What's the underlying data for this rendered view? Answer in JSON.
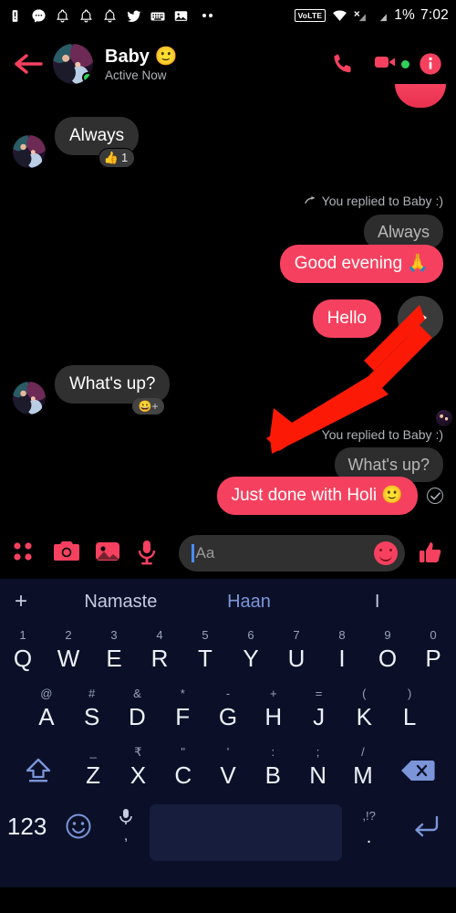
{
  "statusbar": {
    "icons": [
      "battery-alert-icon",
      "messenger-chat-icon",
      "bell-icon",
      "bell-icon",
      "bell-icon",
      "twitter-bird-icon",
      "keyboard-icon",
      "image-icon",
      "more-dots-icon"
    ],
    "volte_label": "VoLTE",
    "wifi_icon": "wifi-icon",
    "signal_icons": [
      "signal-no-service-icon",
      "signal-bars-icon"
    ],
    "battery_percent": "1%",
    "time": "7:02"
  },
  "header": {
    "back_icon": "back-arrow-icon",
    "avatar_name": "avatar",
    "name": "Baby 🙂",
    "status": "Active Now",
    "call_icon": "phone-call-icon",
    "video_icon": "video-call-icon",
    "info_icon": "info-icon"
  },
  "thread": {
    "messages": [
      {
        "id": "m1",
        "direction": "in",
        "text": "Always",
        "reaction": {
          "emoji": "👍",
          "count": "1"
        }
      },
      {
        "id": "m2",
        "direction": "out",
        "reply_label": "You replied to Baby :)",
        "quote": "Always",
        "text": "Good evening 🙏"
      },
      {
        "id": "m3",
        "direction": "out",
        "text": "Hello",
        "reply_button": "reply-button"
      },
      {
        "id": "m4",
        "direction": "in",
        "text": "What's up?",
        "add_reaction": "😀+"
      },
      {
        "id": "m5",
        "direction": "out",
        "reply_label": "You replied to Baby :)",
        "quote": "What's up?",
        "text": "Just done with Holi 🙂",
        "delivered": "✓"
      }
    ]
  },
  "composer": {
    "apps_icon": "four-dots-grid-icon",
    "camera_icon": "camera-icon",
    "gallery_icon": "gallery-icon",
    "mic_icon": "microphone-icon",
    "input_value": "",
    "input_placeholder": "Aa",
    "emoji_icon": "smiley-emoji-icon",
    "like_icon": "thumbs-up-icon"
  },
  "keyboard": {
    "suggestions": {
      "add": "+",
      "items": [
        "Namaste",
        "Haan",
        "I"
      ],
      "highlighted_index": 1
    },
    "row1": [
      {
        "key": "Q",
        "sup": "1"
      },
      {
        "key": "W",
        "sup": "2"
      },
      {
        "key": "E",
        "sup": "3"
      },
      {
        "key": "R",
        "sup": "4"
      },
      {
        "key": "T",
        "sup": "5"
      },
      {
        "key": "Y",
        "sup": "6"
      },
      {
        "key": "U",
        "sup": "7"
      },
      {
        "key": "I",
        "sup": "8"
      },
      {
        "key": "O",
        "sup": "9"
      },
      {
        "key": "P",
        "sup": "0"
      }
    ],
    "row2": [
      {
        "key": "A",
        "sup": "@"
      },
      {
        "key": "S",
        "sup": "#"
      },
      {
        "key": "D",
        "sup": "&"
      },
      {
        "key": "F",
        "sup": "*"
      },
      {
        "key": "G",
        "sup": "-"
      },
      {
        "key": "H",
        "sup": "+"
      },
      {
        "key": "J",
        "sup": "="
      },
      {
        "key": "K",
        "sup": "("
      },
      {
        "key": "L",
        "sup": ")"
      }
    ],
    "row3": {
      "shift": "shift-key-icon",
      "keys": [
        {
          "key": "Z",
          "sup": "_"
        },
        {
          "key": "X",
          "sup": "₹"
        },
        {
          "key": "C",
          "sup": "\""
        },
        {
          "key": "V",
          "sup": "'"
        },
        {
          "key": "B",
          "sup": ":"
        },
        {
          "key": "N",
          "sup": ";"
        },
        {
          "key": "M",
          "sup": "/"
        }
      ],
      "backspace": "backspace-key-icon"
    },
    "row4": {
      "numeric": "123",
      "emoji": "emoji-key-icon",
      "mic": "microphone-key-icon",
      "mic_sub": ",",
      "space": "",
      "period_top": ",!?",
      "period": ".",
      "enter": "enter-key-icon"
    }
  },
  "annotation": {
    "arrow": "red-pointer-arrow"
  },
  "colors": {
    "accent": "#f5415f",
    "bubble_in": "#303030",
    "keyboard_bg": "#0b1028",
    "key_blue": "#7b95d8",
    "online": "#31d158"
  }
}
